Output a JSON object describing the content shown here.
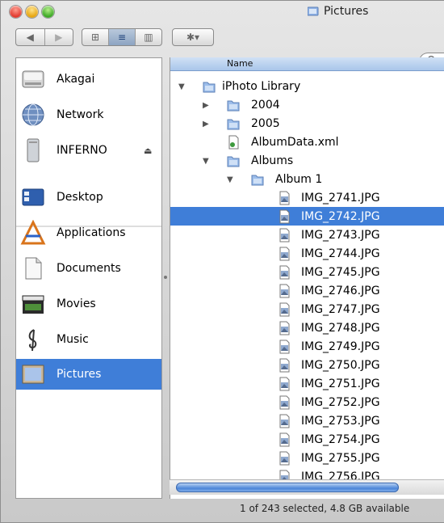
{
  "window": {
    "title": "Pictures"
  },
  "toolbar": {
    "back_glyph": "◀",
    "forward_glyph": "▶",
    "view_icon": "⊞",
    "list_icon": "≡",
    "column_icon": "▥",
    "action_glyph": "✱▾",
    "search_glyph": "Q"
  },
  "sidebar": {
    "items": [
      {
        "label": "Akagai",
        "icon": "hard-drive-icon"
      },
      {
        "label": "Network",
        "icon": "network-globe-icon"
      },
      {
        "label": "INFERNO",
        "icon": "computer-icon",
        "eject": "⏏"
      },
      {
        "label": "Desktop",
        "icon": "desktop-icon"
      },
      {
        "label": "Applications",
        "icon": "applications-icon"
      },
      {
        "label": "Documents",
        "icon": "documents-icon"
      },
      {
        "label": "Movies",
        "icon": "movies-clapboard-icon"
      },
      {
        "label": "Music",
        "icon": "music-clef-icon"
      },
      {
        "label": "Pictures",
        "icon": "pictures-frame-icon",
        "selected": true
      }
    ]
  },
  "browser": {
    "column_header": "Name",
    "rows": [
      {
        "name": "iPhoto Library",
        "type": "folder",
        "level": 0,
        "expanded": true
      },
      {
        "name": "2004",
        "type": "folder",
        "level": 1,
        "expanded": false
      },
      {
        "name": "2005",
        "type": "folder",
        "level": 1,
        "expanded": false
      },
      {
        "name": "AlbumData.xml",
        "type": "xml",
        "level": 1
      },
      {
        "name": "Albums",
        "type": "folder",
        "level": 1,
        "expanded": true
      },
      {
        "name": "Album 1",
        "type": "folder",
        "level": 2,
        "expanded": true
      },
      {
        "name": "IMG_2741.JPG",
        "type": "image",
        "level": 3
      },
      {
        "name": "IMG_2742.JPG",
        "type": "image",
        "level": 3,
        "selected": true
      },
      {
        "name": "IMG_2743.JPG",
        "type": "image",
        "level": 3
      },
      {
        "name": "IMG_2744.JPG",
        "type": "image",
        "level": 3
      },
      {
        "name": "IMG_2745.JPG",
        "type": "image",
        "level": 3
      },
      {
        "name": "IMG_2746.JPG",
        "type": "image",
        "level": 3
      },
      {
        "name": "IMG_2747.JPG",
        "type": "image",
        "level": 3
      },
      {
        "name": "IMG_2748.JPG",
        "type": "image",
        "level": 3
      },
      {
        "name": "IMG_2749.JPG",
        "type": "image",
        "level": 3
      },
      {
        "name": "IMG_2750.JPG",
        "type": "image",
        "level": 3
      },
      {
        "name": "IMG_2751.JPG",
        "type": "image",
        "level": 3
      },
      {
        "name": "IMG_2752.JPG",
        "type": "image",
        "level": 3
      },
      {
        "name": "IMG_2753.JPG",
        "type": "image",
        "level": 3
      },
      {
        "name": "IMG_2754.JPG",
        "type": "image",
        "level": 3
      },
      {
        "name": "IMG_2755.JPG",
        "type": "image",
        "level": 3
      },
      {
        "name": "IMG_2756.JPG",
        "type": "image",
        "level": 3
      }
    ]
  },
  "status": {
    "text": "1 of 243 selected, 4.8 GB available"
  },
  "colors": {
    "selection": "#3f7ed8",
    "folder": "#7ba7e0"
  }
}
